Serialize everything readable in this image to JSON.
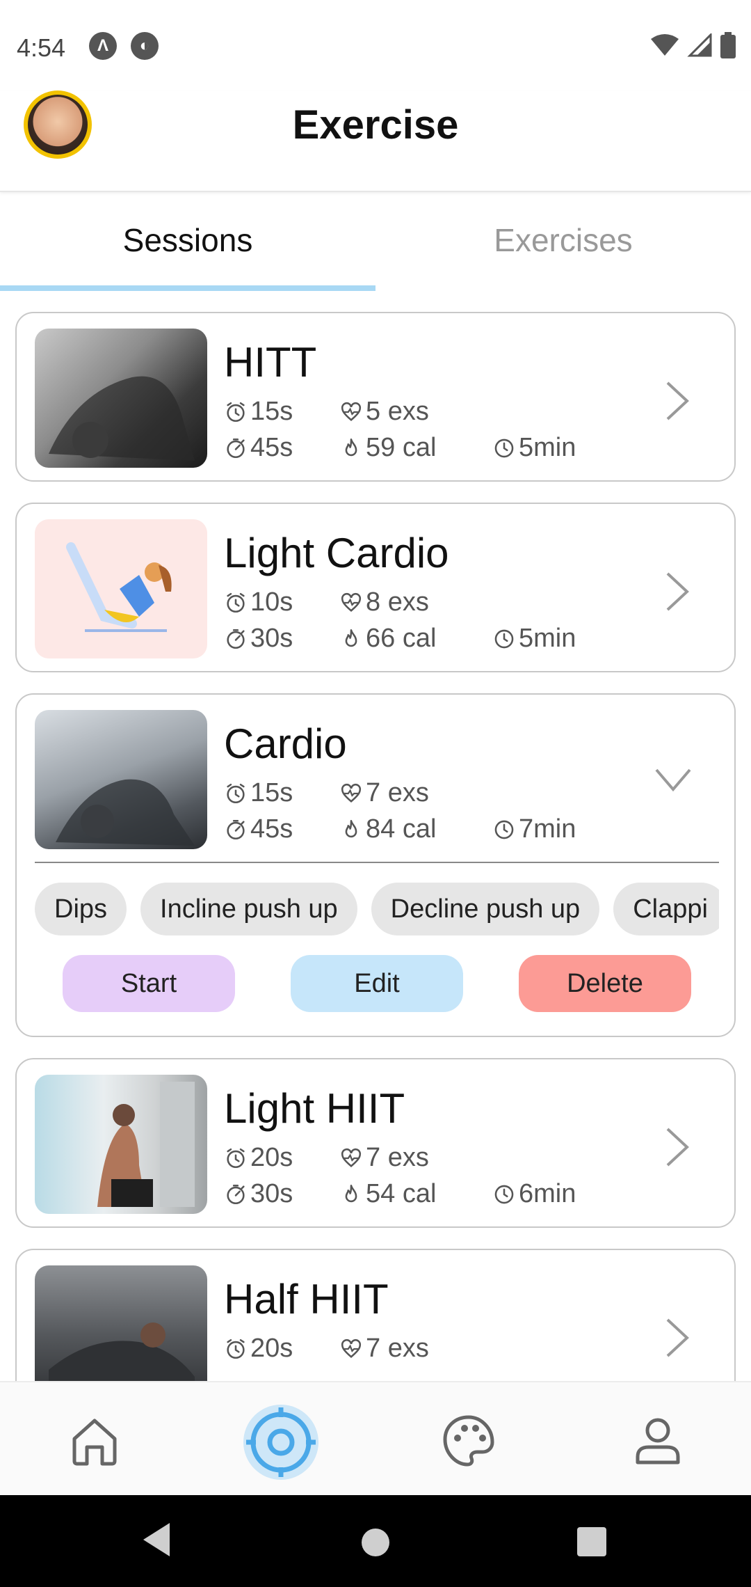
{
  "status_bar": {
    "time": "4:54"
  },
  "header": {
    "title": "Exercise"
  },
  "tabs": [
    {
      "label": "Sessions",
      "active": true
    },
    {
      "label": "Exercises",
      "active": false
    }
  ],
  "sessions": [
    {
      "name": "HITT",
      "rest": "15s",
      "exercises": "5 exs",
      "work": "45s",
      "calories": "59 cal",
      "duration": "5min",
      "expanded": false
    },
    {
      "name": "Light Cardio",
      "rest": "10s",
      "exercises": "8 exs",
      "work": "30s",
      "calories": "66 cal",
      "duration": "5min",
      "expanded": false
    },
    {
      "name": "Cardio",
      "rest": "15s",
      "exercises": "7 exs",
      "work": "45s",
      "calories": "84 cal",
      "duration": "7min",
      "expanded": true,
      "exercise_chips": [
        "Dips",
        "Incline push up",
        "Decline push up",
        "Clappi"
      ],
      "actions": {
        "start": "Start",
        "edit": "Edit",
        "delete": "Delete"
      }
    },
    {
      "name": "Light HIIT",
      "rest": "20s",
      "exercises": "7 exs",
      "work": "30s",
      "calories": "54 cal",
      "duration": "6min",
      "expanded": false
    },
    {
      "name": "Half HIIT",
      "rest": "20s",
      "exercises": "7 exs",
      "expanded": false
    }
  ],
  "bottom_nav": [
    {
      "icon": "home-icon",
      "active": false
    },
    {
      "icon": "target-icon",
      "active": true
    },
    {
      "icon": "palette-icon",
      "active": false
    },
    {
      "icon": "profile-icon",
      "active": false
    }
  ],
  "colors": {
    "tab_indicator": "#a8d8f4",
    "start_button": "#e6cdf9",
    "edit_button": "#c6e6fa",
    "delete_button": "#fc9b95",
    "avatar_ring": "#f2c200",
    "nav_active": "#4aa8e8"
  }
}
